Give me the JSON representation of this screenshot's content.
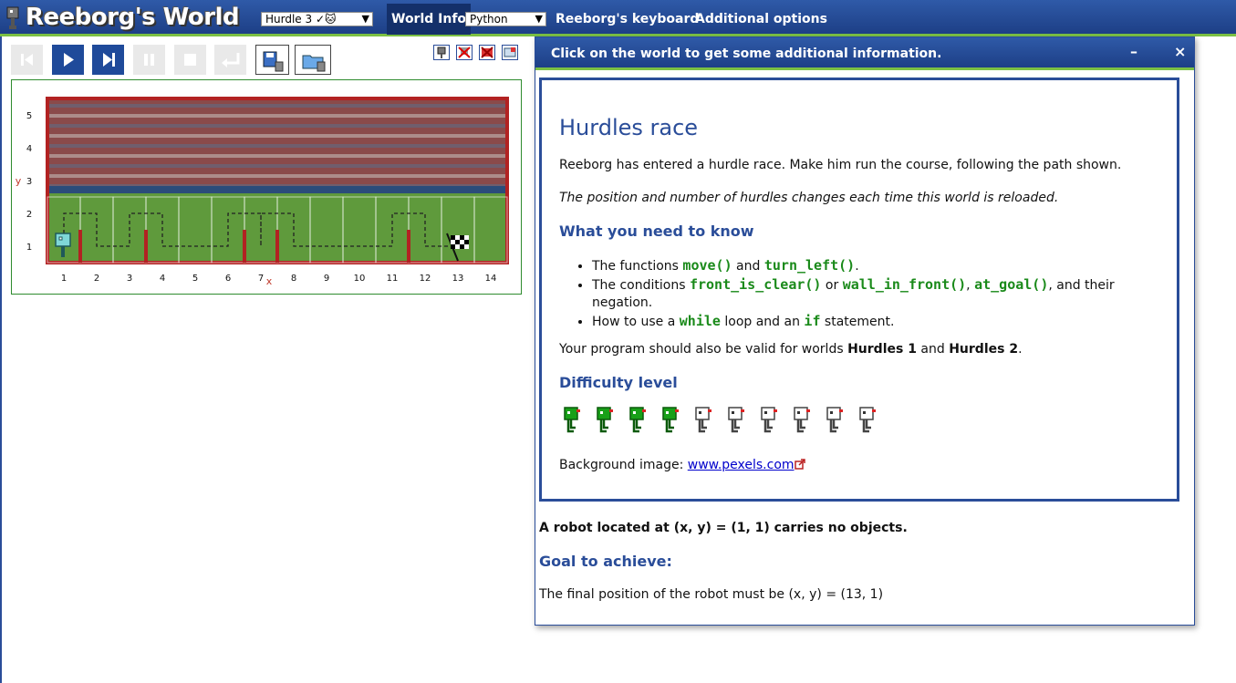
{
  "app": {
    "title": "Reeborg's World"
  },
  "topbar": {
    "world_select": "Hurdle 3 ✓🐱",
    "world_info": "World Info",
    "language_select": "Python",
    "keyboard": "Reeborg's keyboard",
    "options": "Additional options"
  },
  "toolbar": {
    "buttons": [
      "reload",
      "run",
      "step",
      "pause",
      "stop",
      "return"
    ],
    "save": "save-world",
    "open": "open-world"
  },
  "world": {
    "x_ticks": [
      "1",
      "2",
      "3",
      "4",
      "5",
      "6",
      "7",
      "8",
      "9",
      "10",
      "11",
      "12",
      "13",
      "14"
    ],
    "y_ticks": [
      "1",
      "2",
      "3",
      "4",
      "5"
    ],
    "x_axis_label": "x",
    "y_axis_label": "y",
    "robot": {
      "x": 1,
      "y": 1
    },
    "goal": {
      "x": 13,
      "y": 1
    },
    "hurdles_after_x": [
      1,
      3,
      6,
      7,
      11
    ]
  },
  "dialog": {
    "title": "Click on the world to get some additional information.",
    "minimize": "–",
    "close": "×",
    "heading": "Hurdles race",
    "intro": "Reeborg has entered a hurdle race. Make him run the course, following the path shown.",
    "note": "The position and number of hurdles changes each time this world is reloaded.",
    "need_heading": "What you need to know",
    "bullets": {
      "b1_pre": "The functions ",
      "b1_c1": "move()",
      "b1_mid": " and ",
      "b1_c2": "turn_left()",
      "b1_post": ".",
      "b2_pre": "The conditions ",
      "b2_c1": "front_is_clear()",
      "b2_mid1": " or ",
      "b2_c2": "wall_in_front()",
      "b2_mid2": ", ",
      "b2_c3": "at_goal()",
      "b2_post": ", and their negation.",
      "b3_pre": "How to use a ",
      "b3_c1": "while",
      "b3_mid": " loop and an ",
      "b3_c2": "if",
      "b3_post": " statement."
    },
    "valid_pre": "Your program should also be valid for worlds ",
    "valid_w1": "Hurdles 1",
    "valid_mid": " and ",
    "valid_w2": "Hurdles 2",
    "valid_post": ".",
    "difficulty_heading": "Difficulty level",
    "difficulty": {
      "level": 4,
      "max": 10
    },
    "bg_label": "Background image: ",
    "bg_link": "www.pexels.com",
    "robot_status": "A robot located at (x, y) = (1, 1) carries no objects.",
    "goal_heading": "Goal to achieve:",
    "goal_text": "The final position of the robot must be (x, y) = (13, 1)"
  },
  "colors": {
    "bar_blue": "#1d3f86",
    "accent_green": "#7bc043",
    "heading_blue": "#2a4d99",
    "code_green": "#1a8a1a",
    "wall_red": "#b22222"
  }
}
